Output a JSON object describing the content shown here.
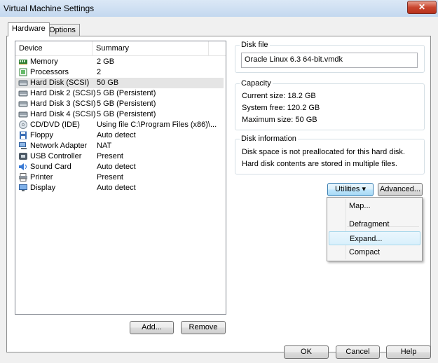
{
  "window": {
    "title": "Virtual Machine Settings",
    "close_glyph": "✕"
  },
  "tabs": [
    {
      "label": "Hardware"
    },
    {
      "label": "Options"
    }
  ],
  "device_list": {
    "columns": {
      "device": "Device",
      "summary": "Summary"
    },
    "rows": [
      {
        "device": "Memory",
        "summary": "2 GB",
        "icon": "memory-icon"
      },
      {
        "device": "Processors",
        "summary": "2",
        "icon": "processor-icon"
      },
      {
        "device": "Hard Disk (SCSI)",
        "summary": "50 GB",
        "icon": "hard-disk-icon",
        "selected": true
      },
      {
        "device": "Hard Disk 2 (SCSI)",
        "summary": "5 GB (Persistent)",
        "icon": "hard-disk-icon"
      },
      {
        "device": "Hard Disk 3 (SCSI)",
        "summary": "5 GB (Persistent)",
        "icon": "hard-disk-icon"
      },
      {
        "device": "Hard Disk 4 (SCSI)",
        "summary": "5 GB (Persistent)",
        "icon": "hard-disk-icon"
      },
      {
        "device": "CD/DVD (IDE)",
        "summary": "Using file C:\\Program Files (x86)\\...",
        "icon": "cd-dvd-icon"
      },
      {
        "device": "Floppy",
        "summary": "Auto detect",
        "icon": "floppy-icon"
      },
      {
        "device": "Network Adapter",
        "summary": "NAT",
        "icon": "network-adapter-icon"
      },
      {
        "device": "USB Controller",
        "summary": "Present",
        "icon": "usb-icon"
      },
      {
        "device": "Sound Card",
        "summary": "Auto detect",
        "icon": "sound-card-icon"
      },
      {
        "device": "Printer",
        "summary": "Present",
        "icon": "printer-icon"
      },
      {
        "device": "Display",
        "summary": "Auto detect",
        "icon": "display-icon"
      }
    ]
  },
  "buttons": {
    "add": "Add...",
    "remove": "Remove",
    "utilities": "Utilities ▾",
    "advanced": "Advanced...",
    "ok": "OK",
    "cancel": "Cancel",
    "help": "Help"
  },
  "disk_file": {
    "title": "Disk file",
    "value": "Oracle Linux 6.3 64-bit.vmdk"
  },
  "capacity": {
    "title": "Capacity",
    "current_size": "Current size: 18.2 GB",
    "system_free": "System free: 120.2 GB",
    "maximum_size": "Maximum size: 50 GB"
  },
  "disk_information": {
    "title": "Disk information",
    "line1": "Disk space is not preallocated for this hard disk.",
    "line2": "Hard disk contents are stored in multiple files."
  },
  "utilities_menu": [
    {
      "label": "Map..."
    },
    {
      "label": "Defragment"
    },
    {
      "label": "Expand...",
      "hover": true
    },
    {
      "label": "Compact"
    }
  ],
  "colors": {
    "selection": "#e5e5e5",
    "menu_hover": "#d9f0fc",
    "close": "#c9462f"
  }
}
